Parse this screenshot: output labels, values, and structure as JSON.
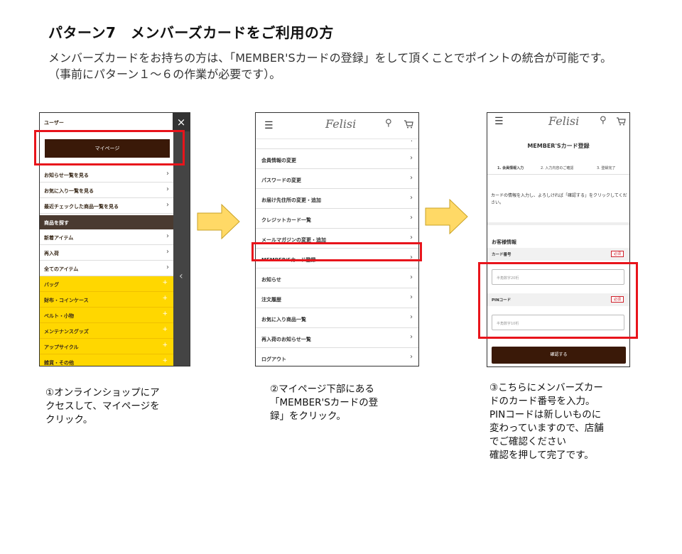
{
  "title": "パターン7　メンバーズカードをご利用の方",
  "description": "メンバーズカードをお持ちの方は、「MEMBER'Sカードの登録」をして頂くことでポイントの統合が可能です。（事前にパターン１～６の作業が必要です）。",
  "step1": {
    "caption": "①オンラインショップにア\nクセスして、マイページを\nクリック。",
    "user_label": "ユーザー",
    "close_icon": "×",
    "mypage_button": "マイページ",
    "menu_items": [
      {
        "label": "お知らせ一覧を見る"
      },
      {
        "label": "お気に入り一覧を見る"
      },
      {
        "label": "最近チェックした商品一覧を見る"
      }
    ],
    "section_label": "商品を探す",
    "product_items": [
      {
        "label": "新着アイテム"
      },
      {
        "label": "再入荷"
      },
      {
        "label": "全てのアイテム"
      }
    ],
    "category_items": [
      {
        "label": "バッグ"
      },
      {
        "label": "財布・コインケース"
      },
      {
        "label": "ベルト・小物"
      },
      {
        "label": "メンテナンスグッズ"
      },
      {
        "label": "アップサイクル"
      },
      {
        "label": "雑貨・その他"
      }
    ]
  },
  "step2": {
    "caption": "②マイページ下部にある\n「MEMBER'Sカードの登\n録」をクリック。",
    "logo": "Felisi",
    "menu_items": [
      {
        "label": "会員情報の変更"
      },
      {
        "label": "パスワードの変更"
      },
      {
        "label": "お届け先住所の変更・追加"
      },
      {
        "label": "クレジットカード一覧"
      },
      {
        "label": "メールマガジンの変更・追加"
      },
      {
        "label": "MEMBER'Sカード登録"
      },
      {
        "label": "お知らせ"
      },
      {
        "label": "注文履歴"
      },
      {
        "label": "お気に入り商品一覧"
      },
      {
        "label": "再入荷のお知らせ一覧"
      },
      {
        "label": "ログアウト"
      }
    ]
  },
  "step3": {
    "caption": "③こちらにメンバーズカー\nドのカード番号を入力。\nPINコードは新しいものに\n変わっていますので、店舗\nでご確認ください\n確認を押して完了です。",
    "logo": "Felisi",
    "page_title": "MEMBER'Sカード登録",
    "steps": [
      "1. 会員情報入力",
      "2. 入力内容のご確認",
      "3. 登録完了"
    ],
    "note": "カードの情報を入力し、よろしければ「確認する」をクリックしてください。",
    "customer_info": "お客様情報",
    "card_number_label": "カード番号",
    "required": "必須",
    "card_number_placeholder": "半角数字20桁",
    "pin_label": "PINコード",
    "pin_placeholder": "半角数字10桁",
    "confirm_button": "確認する"
  },
  "colors": {
    "highlight": "#e8141b",
    "brand_dark": "#3a1908",
    "category_yellow": "#ffd700",
    "arrow_fill": "#ffd966"
  }
}
